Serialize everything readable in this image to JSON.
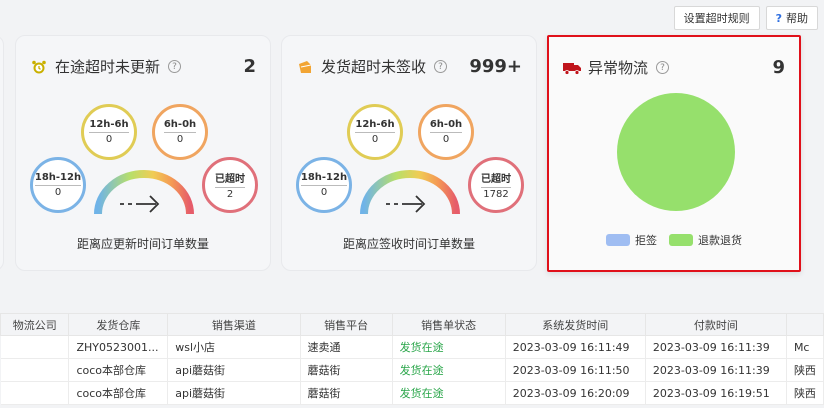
{
  "toolbar": {
    "timeout_rules_label": "设置超时规则",
    "help_label": "帮助",
    "help_glyph": "?"
  },
  "cards": [
    {
      "title": "在途超时未更新",
      "icon": "alarm-clock-icon",
      "count": "2",
      "bubbles": [
        {
          "label": "12h-6h",
          "value": "0"
        },
        {
          "label": "6h-0h",
          "value": "0"
        },
        {
          "label": "18h-12h",
          "value": "0"
        },
        {
          "label": "已超时",
          "value": "2"
        }
      ],
      "footer": "距离应更新时间订单数量"
    },
    {
      "title": "发货超时未签收",
      "icon": "package-icon",
      "count": "999+",
      "bubbles": [
        {
          "label": "12h-6h",
          "value": "0"
        },
        {
          "label": "6h-0h",
          "value": "0"
        },
        {
          "label": "18h-12h",
          "value": "0"
        },
        {
          "label": "已超时",
          "value": "1782"
        }
      ],
      "footer": "距离应签收时间订单数量"
    },
    {
      "title": "异常物流",
      "icon": "truck-icon",
      "count": "9",
      "legend": [
        {
          "label": "拒签",
          "color": "#9fbdf2"
        },
        {
          "label": "退款退货",
          "color": "#96e06c"
        }
      ]
    }
  ],
  "chart_data": {
    "type": "pie",
    "categories": [
      "拒签",
      "退款退货"
    ],
    "values": [
      0,
      9
    ],
    "colors": [
      "#9fbdf2",
      "#96e06c"
    ],
    "legend_position": "bottom"
  },
  "table": {
    "headers": [
      "物流公司",
      "发货仓库",
      "销售渠道",
      "销售平台",
      "销售单状态",
      "系统发货时间",
      "付款时间",
      ""
    ],
    "rows": [
      [
        "",
        "ZHY0523001...",
        "wsl小店",
        "速卖通",
        "发货在途",
        "2023-03-09 16:11:49",
        "2023-03-09 16:11:39",
        "Mc"
      ],
      [
        "",
        "coco本部仓库",
        "api蘑菇街",
        "蘑菇街",
        "发货在途",
        "2023-03-09 16:11:50",
        "2023-03-09 16:11:39",
        "陕西"
      ],
      [
        "",
        "coco本部仓库",
        "api蘑菇街",
        "蘑菇街",
        "发货在途",
        "2023-03-09 16:20:09",
        "2023-03-09 16:19:51",
        "陕西"
      ]
    ]
  }
}
